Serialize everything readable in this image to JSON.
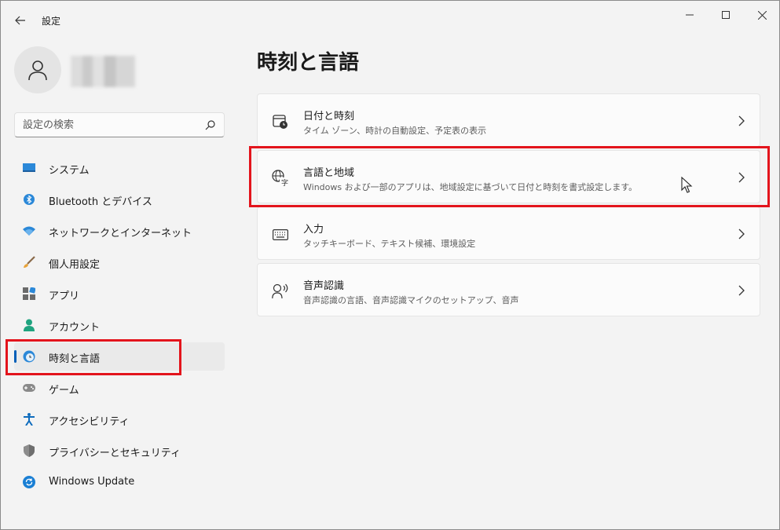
{
  "window": {
    "title": "設定"
  },
  "search": {
    "placeholder": "設定の検索"
  },
  "sidebar": {
    "items": [
      {
        "label": "システム",
        "icon": "system-icon"
      },
      {
        "label": "Bluetooth とデバイス",
        "icon": "bluetooth-icon"
      },
      {
        "label": "ネットワークとインターネット",
        "icon": "network-icon"
      },
      {
        "label": "個人用設定",
        "icon": "brush-icon"
      },
      {
        "label": "アプリ",
        "icon": "apps-icon"
      },
      {
        "label": "アカウント",
        "icon": "account-icon"
      },
      {
        "label": "時刻と言語",
        "icon": "time-language-icon",
        "selected": true
      },
      {
        "label": "ゲーム",
        "icon": "gamepad-icon"
      },
      {
        "label": "アクセシビリティ",
        "icon": "accessibility-icon"
      },
      {
        "label": "プライバシーとセキュリティ",
        "icon": "shield-icon"
      },
      {
        "label": "Windows Update",
        "icon": "windows-update-icon"
      }
    ]
  },
  "main": {
    "title": "時刻と言語",
    "cards": [
      {
        "title": "日付と時刻",
        "description": "タイム ゾーン、時計の自動設定、予定表の表示",
        "icon": "calendar-clock-icon"
      },
      {
        "title": "言語と地域",
        "description": "Windows および一部のアプリは、地域設定に基づいて日付と時刻を書式設定します。",
        "icon": "language-icon"
      },
      {
        "title": "入力",
        "description": "タッチキーボード、テキスト候補、環境設定",
        "icon": "keyboard-icon"
      },
      {
        "title": "音声認識",
        "description": "音声認識の言語、音声認識マイクのセットアップ、音声",
        "icon": "speech-icon"
      }
    ]
  },
  "colors": {
    "accent": "#005fb8",
    "highlight": "#e3141c",
    "background": "#f3f3f3",
    "card": "#fbfbfb"
  }
}
